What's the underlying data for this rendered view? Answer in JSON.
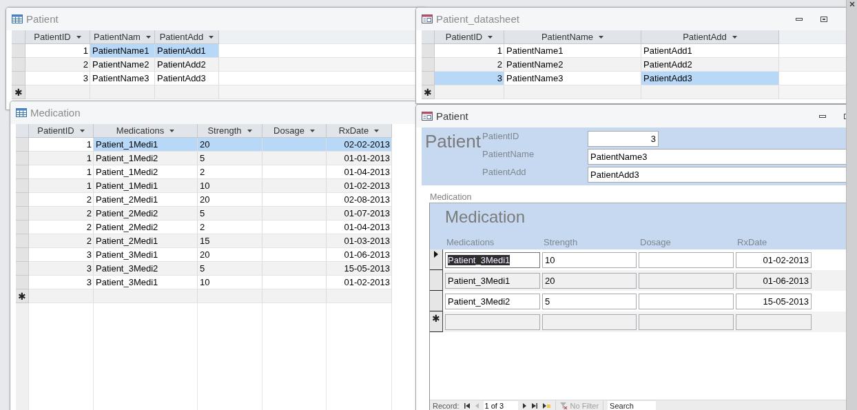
{
  "windows": [
    {
      "kind": "datasheet",
      "title": "Patient",
      "active": false,
      "new_row_marker": "✱",
      "columns": [
        {
          "label": "PatientID"
        },
        {
          "label": "PatientNam"
        },
        {
          "label": "PatientAdd"
        }
      ],
      "rows": [
        {
          "cells": [
            {
              "text": "1",
              "selected": false
            },
            {
              "text": "PatientName1",
              "selected": true
            },
            {
              "text": "PatientAdd1",
              "selected": true
            }
          ]
        },
        {
          "cells": [
            {
              "text": "2",
              "selected": false
            },
            {
              "text": "PatientName2",
              "selected": false
            },
            {
              "text": "PatientAdd2",
              "selected": false
            }
          ]
        },
        {
          "cells": [
            {
              "text": "3",
              "selected": false
            },
            {
              "text": "PatientName3",
              "selected": false
            },
            {
              "text": "PatientAdd3",
              "selected": false
            }
          ]
        }
      ]
    },
    {
      "kind": "datasheet",
      "title": "Medication",
      "active": false,
      "new_row_marker": "✱",
      "columns": [
        {
          "label": "PatientID"
        },
        {
          "label": "Medications"
        },
        {
          "label": "Strength"
        },
        {
          "label": "Dosage"
        },
        {
          "label": "RxDate"
        }
      ],
      "rows": [
        {
          "cells": [
            {
              "text": "1",
              "selected": false
            },
            {
              "text": "Patient_1Medi1",
              "selected": true
            },
            {
              "text": "20",
              "selected": true
            },
            {
              "text": "",
              "selected": true
            },
            {
              "text": "02-02-2013",
              "selected": true
            }
          ]
        },
        {
          "cells": [
            {
              "text": "1",
              "selected": false
            },
            {
              "text": "Patient_1Medi2",
              "selected": false
            },
            {
              "text": "5",
              "selected": false
            },
            {
              "text": "",
              "selected": false
            },
            {
              "text": "01-01-2013",
              "selected": false
            }
          ]
        },
        {
          "cells": [
            {
              "text": "1",
              "selected": false
            },
            {
              "text": "Patient_1Medi2",
              "selected": false
            },
            {
              "text": "2",
              "selected": false
            },
            {
              "text": "",
              "selected": false
            },
            {
              "text": "01-04-2013",
              "selected": false
            }
          ]
        },
        {
          "cells": [
            {
              "text": "1",
              "selected": false
            },
            {
              "text": "Patient_1Medi1",
              "selected": false
            },
            {
              "text": "10",
              "selected": false
            },
            {
              "text": "",
              "selected": false
            },
            {
              "text": "01-02-2013",
              "selected": false
            }
          ]
        },
        {
          "cells": [
            {
              "text": "2",
              "selected": false
            },
            {
              "text": "Patient_2Medi1",
              "selected": false
            },
            {
              "text": "20",
              "selected": false
            },
            {
              "text": "",
              "selected": false
            },
            {
              "text": "02-08-2013",
              "selected": false
            }
          ]
        },
        {
          "cells": [
            {
              "text": "2",
              "selected": false
            },
            {
              "text": "Patient_2Medi2",
              "selected": false
            },
            {
              "text": "5",
              "selected": false
            },
            {
              "text": "",
              "selected": false
            },
            {
              "text": "01-07-2013",
              "selected": false
            }
          ]
        },
        {
          "cells": [
            {
              "text": "2",
              "selected": false
            },
            {
              "text": "Patient_2Medi2",
              "selected": false
            },
            {
              "text": "2",
              "selected": false
            },
            {
              "text": "",
              "selected": false
            },
            {
              "text": "01-04-2013",
              "selected": false
            }
          ]
        },
        {
          "cells": [
            {
              "text": "2",
              "selected": false
            },
            {
              "text": "Patient_2Medi1",
              "selected": false
            },
            {
              "text": "15",
              "selected": false
            },
            {
              "text": "",
              "selected": false
            },
            {
              "text": "01-03-2013",
              "selected": false
            }
          ]
        },
        {
          "cells": [
            {
              "text": "3",
              "selected": false
            },
            {
              "text": "Patient_3Medi1",
              "selected": false
            },
            {
              "text": "20",
              "selected": false
            },
            {
              "text": "",
              "selected": false
            },
            {
              "text": "01-06-2013",
              "selected": false
            }
          ]
        },
        {
          "cells": [
            {
              "text": "3",
              "selected": false
            },
            {
              "text": "Patient_3Medi2",
              "selected": false
            },
            {
              "text": "5",
              "selected": false
            },
            {
              "text": "",
              "selected": false
            },
            {
              "text": "15-05-2013",
              "selected": false
            }
          ]
        },
        {
          "cells": [
            {
              "text": "3",
              "selected": false
            },
            {
              "text": "Patient_3Medi1",
              "selected": false
            },
            {
              "text": "10",
              "selected": false
            },
            {
              "text": "",
              "selected": false
            },
            {
              "text": "01-02-2013",
              "selected": false
            }
          ]
        }
      ]
    },
    {
      "kind": "datasheet",
      "title": "Patient_datasheet",
      "active": false,
      "new_row_marker": "✱",
      "columns": [
        {
          "label": "PatientID"
        },
        {
          "label": "PatientName"
        },
        {
          "label": "PatientAdd"
        }
      ],
      "rows": [
        {
          "cells": [
            {
              "text": "1",
              "selected": false
            },
            {
              "text": "PatientName1",
              "selected": false
            },
            {
              "text": "PatientAdd1",
              "selected": false
            }
          ]
        },
        {
          "cells": [
            {
              "text": "2",
              "selected": false
            },
            {
              "text": "PatientName2",
              "selected": false
            },
            {
              "text": "PatientAdd2",
              "selected": false
            }
          ]
        },
        {
          "cells": [
            {
              "text": "3",
              "selected": true
            },
            {
              "text": "PatientName3",
              "selected": false
            },
            {
              "text": "PatientAdd3",
              "selected": true
            }
          ]
        }
      ]
    },
    {
      "kind": "form",
      "title": "Patient",
      "active": true,
      "heading": "Patient",
      "fields": [
        {
          "label": "PatientID",
          "value": "3"
        },
        {
          "label": "PatientName",
          "value": "PatientName3"
        },
        {
          "label": "PatientAdd",
          "value": "PatientAdd3"
        }
      ],
      "subform": {
        "caption": "Medication",
        "heading": "Medication",
        "columns": [
          {
            "label": "Medications"
          },
          {
            "label": "Strength"
          },
          {
            "label": "Dosage"
          },
          {
            "label": "RxDate"
          }
        ],
        "new_row_marker": "✱",
        "rows": [
          {
            "current": true,
            "cells": [
              {
                "text": "Patient_3Medi1",
                "selected": true
              },
              {
                "text": "10",
                "selected": false
              },
              {
                "text": "",
                "selected": false
              },
              {
                "text": "01-02-2013",
                "selected": false
              }
            ]
          },
          {
            "current": false,
            "cells": [
              {
                "text": "Patient_3Medi1",
                "selected": false
              },
              {
                "text": "20",
                "selected": false
              },
              {
                "text": "",
                "selected": false
              },
              {
                "text": "01-06-2013",
                "selected": false
              }
            ]
          },
          {
            "current": false,
            "cells": [
              {
                "text": "Patient_3Medi2",
                "selected": false
              },
              {
                "text": "5",
                "selected": false
              },
              {
                "text": "",
                "selected": false
              },
              {
                "text": "15-05-2013",
                "selected": false
              }
            ]
          }
        ],
        "navigation": {
          "label": "Record:",
          "position": "1 of 3",
          "filter": "No Filter",
          "search": {
            "placeholder": "Search"
          }
        }
      }
    }
  ]
}
